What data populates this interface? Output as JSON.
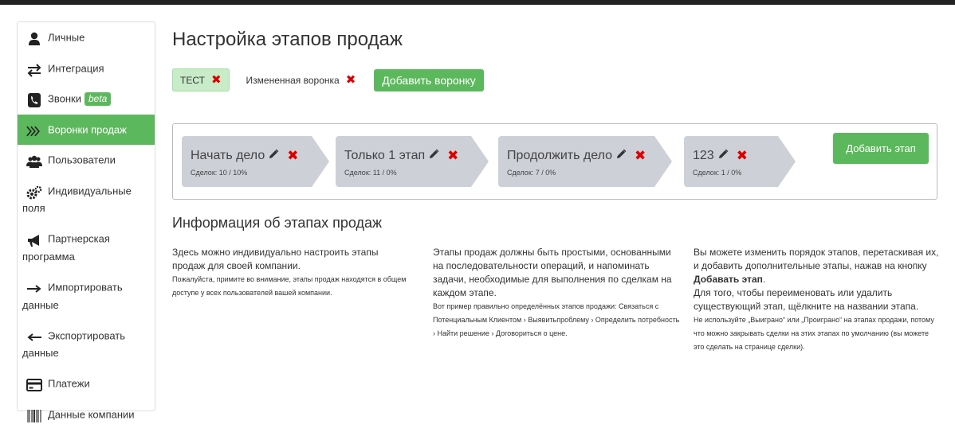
{
  "sidebar": {
    "items": [
      {
        "icon": "user-icon",
        "label": "Личные"
      },
      {
        "icon": "transfer-arrows-icon",
        "label": "Интеграция"
      },
      {
        "icon": "phone-icon",
        "label": "Звонки",
        "badge": "beta"
      },
      {
        "icon": "funnel-chevrons-icon",
        "label": "Воронки продаж",
        "active": true
      },
      {
        "icon": "users-icon",
        "label": "Пользователи"
      },
      {
        "icon": "gears-icon",
        "label": "Индивидуальные",
        "label2": "поля"
      },
      {
        "icon": "megaphone-icon",
        "label": "Партнерская",
        "label2": "программа"
      },
      {
        "icon": "arrow-right-icon",
        "label": "Импортировать",
        "label2": "данные"
      },
      {
        "icon": "arrow-left-icon",
        "label": "Экспортировать",
        "label2": "данные"
      },
      {
        "icon": "credit-card-icon",
        "label": "Платежи"
      },
      {
        "icon": "barcode-icon",
        "label": "Данные компании"
      }
    ]
  },
  "page_title": "Настройка этапов продаж",
  "funnels": [
    {
      "label": "ТЕСТ",
      "active": true
    },
    {
      "label": "Измененная воронка",
      "active": false
    }
  ],
  "add_funnel_label": "Добавить воронку",
  "stages": [
    {
      "name": "Начать дело",
      "deals": "Сделок: 10 / 10%"
    },
    {
      "name": "Только 1 этап",
      "deals": "Сделок: 11 / 0%"
    },
    {
      "name": "Продолжить дело",
      "deals": "Сделок: 7 / 0%"
    },
    {
      "name": "123",
      "deals": "Сделок: 1 / 0%"
    }
  ],
  "add_stage_label": "Добавить этап",
  "info_title": "Информация об этапах продаж",
  "info": {
    "col1": {
      "p1": "Здесь можно индивидуально настроить этапы продаж для своей компании.",
      "p2": "Пожалуйста, примите во внимание, этапы продаж находятся в общем доступе у всех пользователей вашей компании."
    },
    "col2": {
      "p1": "Этапы продаж должны быть простыми, основанными на последовательности операций, и напоминать задачи, необходимые для выполнения по сделкам на каждом этапе.",
      "p2": "Вот пример правильно определённых этапов продажи: Связаться с Потенциальным Клиентом › Выявитьпроблему › Определить потребность › Найти решение › Договориться о цене."
    },
    "col3": {
      "p1a": "Вы можете изменить порядок этапов, перетаскивая их, и добавить дополнительные этапы, нажав на кнопку ",
      "p1b": "Добавать этап",
      "p1c": ".",
      "p2": "Для того, чтобы переименовать или удалить существующий этап, щёлкните на названии этапа.",
      "p3": "Не используйте „Выиграно“ или „Проиграно“ на этапах продажи, потому что можно закрывать сделки на этих этапах по умолчанию (вы можете это сделать на странице сделки)."
    }
  },
  "colors": {
    "accent": "#5cb85c",
    "danger": "#d90000",
    "stage_bg": "#cdd0d6"
  }
}
